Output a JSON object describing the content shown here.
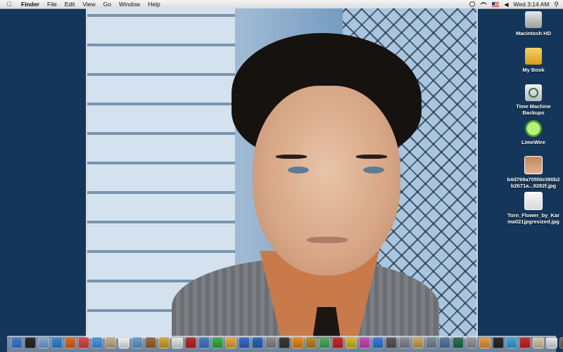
{
  "menubar": {
    "apple_icon": "apple-icon",
    "items": [
      "Finder",
      "File",
      "Edit",
      "View",
      "Go",
      "Window",
      "Help"
    ],
    "clock": "Wed 3:14 AM"
  },
  "desktop_icons": [
    {
      "label": "Macintosh HD",
      "icon": "hard-drive-icon"
    },
    {
      "label": "My Book",
      "icon": "usb-drive-icon"
    },
    {
      "label": "Time Machine Backups",
      "icon": "time-machine-icon"
    },
    {
      "label": "LimeWire",
      "icon": "limewire-icon"
    },
    {
      "label": "b4d769a705fde390b2b2671a...9282f.jpg",
      "icon": "jpg-file-icon"
    },
    {
      "label": "Torn_Flower_by_Karma021jpgresized.jpg",
      "icon": "jpg-file-icon"
    }
  ],
  "dock": {
    "apps": [
      {
        "name": "finder",
        "color": "#3f7dd6"
      },
      {
        "name": "dashboard",
        "color": "#2a2a2a"
      },
      {
        "name": "mail",
        "color": "#7fa8d8"
      },
      {
        "name": "safari",
        "color": "#3a86d8"
      },
      {
        "name": "firefox",
        "color": "#e06b1d"
      },
      {
        "name": "itunes",
        "color": "#d84a4a"
      },
      {
        "name": "ichat",
        "color": "#4a9adf"
      },
      {
        "name": "preview",
        "color": "#c8b08a"
      },
      {
        "name": "ical",
        "color": "#f2f2f2"
      },
      {
        "name": "iphoto",
        "color": "#6aa0d0"
      },
      {
        "name": "imovie",
        "color": "#9a6a3a"
      },
      {
        "name": "garageband",
        "color": "#d8a83a"
      },
      {
        "name": "textedit",
        "color": "#e8e8e8"
      },
      {
        "name": "photobooth",
        "color": "#b82a2a"
      },
      {
        "name": "iweb",
        "color": "#4a7ac8"
      },
      {
        "name": "numbers",
        "color": "#3ab04a"
      },
      {
        "name": "pages",
        "color": "#e8a83a"
      },
      {
        "name": "keynote",
        "color": "#3a6ac8"
      },
      {
        "name": "photoshop",
        "color": "#2a6ab8"
      },
      {
        "name": "script-editor",
        "color": "#8a8a8a"
      },
      {
        "name": "dvd-player",
        "color": "#3a3a3a"
      },
      {
        "name": "illustrator",
        "color": "#e88a1a"
      },
      {
        "name": "bridge",
        "color": "#b88a2a"
      },
      {
        "name": "dreamweaver",
        "color": "#4ab05a"
      },
      {
        "name": "flash",
        "color": "#c82a2a"
      },
      {
        "name": "fireworks",
        "color": "#d8b82a"
      },
      {
        "name": "indesign",
        "color": "#c84ab8"
      },
      {
        "name": "photoshop-2",
        "color": "#3a7ad8"
      },
      {
        "name": "film-clapper",
        "color": "#5a5a5a"
      },
      {
        "name": "system-prefs",
        "color": "#8a8a9a"
      },
      {
        "name": "brush",
        "color": "#c8a85a"
      },
      {
        "name": "grab",
        "color": "#7a8a9a"
      },
      {
        "name": "spaces",
        "color": "#5a7aa8"
      },
      {
        "name": "time-machine",
        "color": "#2f6f56"
      },
      {
        "name": "disk-utility",
        "color": "#9a9a9a"
      },
      {
        "name": "photo-app",
        "color": "#e89a3a"
      },
      {
        "name": "terminal",
        "color": "#2a2a2a"
      },
      {
        "name": "app-store",
        "color": "#3aa8d8"
      },
      {
        "name": "filezilla",
        "color": "#c82a2a"
      },
      {
        "name": "documents-stack",
        "color": "#d8c8a8"
      },
      {
        "name": "downloads-stack",
        "color": "#e8e8e8"
      },
      {
        "name": "trash",
        "color": "#6a6a6a"
      }
    ]
  }
}
